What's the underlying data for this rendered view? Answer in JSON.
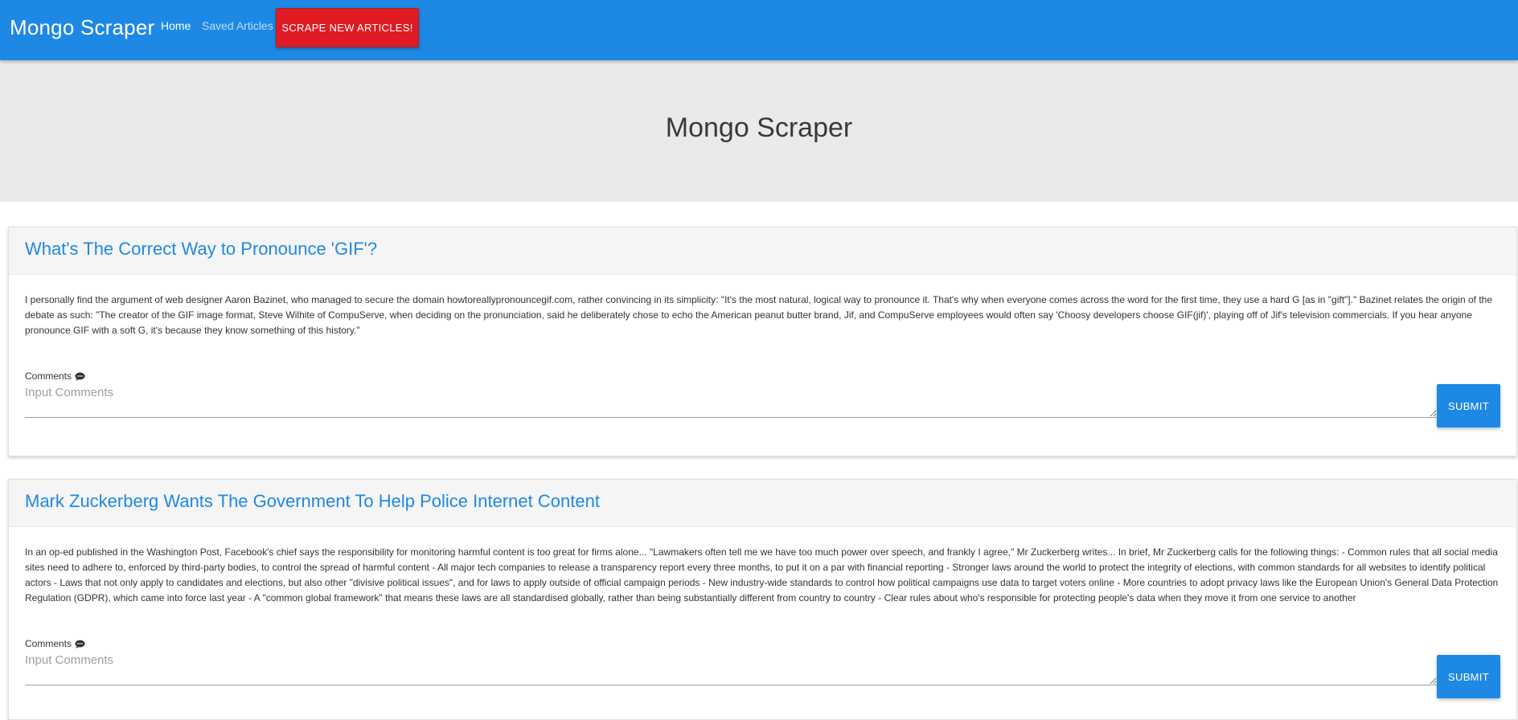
{
  "navbar": {
    "brand": "Mongo Scraper",
    "links": [
      {
        "label": "Home",
        "active": true
      },
      {
        "label": "Saved Articles",
        "active": false
      }
    ],
    "scrape_button": "SCRAPE NEW ARTICLES!"
  },
  "jumbotron": {
    "title": "Mongo Scraper"
  },
  "articles": [
    {
      "title": "What's The Correct Way to Pronounce 'GIF'?",
      "summary": "I personally find the argument of web designer Aaron Bazinet, who managed to secure the domain howtoreallypronouncegif.com, rather convincing in its simplicity: \"It's the most natural, logical way to pronounce it. That's why when everyone comes across the word for the first time, they use a hard G [as in \"gift\"].\" Bazinet relates the origin of the debate as such: \"The creator of the GIF image format, Steve Wilhite of CompuServe, when deciding on the pronunciation, said he deliberately chose to echo the American peanut butter brand, Jif, and CompuServe employees would often say 'Choosy developers choose GIF(jif)', playing off of Jif's television commercials. If you hear anyone pronounce GIF with a soft G, it's because they know something of this history.\"",
      "comments_label": "Comments",
      "comment_placeholder": "Input Comments",
      "comment_value": "",
      "submit_label": "SUBMIT"
    },
    {
      "title": "Mark Zuckerberg Wants The Government To Help Police Internet Content",
      "summary": "In an op-ed published in the Washington Post, Facebook's chief says the responsibility for monitoring harmful content is too great for firms alone... \"Lawmakers often tell me we have too much power over speech, and frankly I agree,\" Mr Zuckerberg writes... In brief, Mr Zuckerberg calls for the following things: - Common rules that all social media sites need to adhere to, enforced by third-party bodies, to control the spread of harmful content - All major tech companies to release a transparency report every three months, to put it on a par with financial reporting - Stronger laws around the world to protect the integrity of elections, with common standards for all websites to identify political actors - Laws that not only apply to candidates and elections, but also other \"divisive political issues\", and for laws to apply outside of official campaign periods - New industry-wide standards to control how political campaigns use data to target voters online - More countries to adopt privacy laws like the European Union's General Data Protection Regulation (GDPR), which came into force last year - A \"common global framework\" that means these laws are all standardised globally, rather than being substantially different from country to country - Clear rules about who's responsible for protecting people's data when they move it from one service to another",
      "comments_label": "Comments",
      "comment_placeholder": "Input Comments",
      "comment_value": "",
      "submit_label": "SUBMIT"
    }
  ],
  "icons": {
    "comment": "comment-dots-icon",
    "resize": "resize-grip-icon"
  },
  "colors": {
    "primary": "#1e88e5",
    "scrape_button": "#e01b24",
    "jumbotron_bg": "#eaeaea",
    "card_header_bg": "#f5f5f5"
  }
}
